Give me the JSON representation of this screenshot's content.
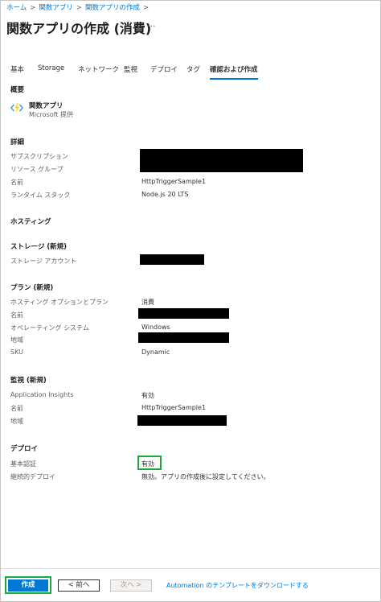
{
  "breadcrumb": {
    "items": [
      "ホーム",
      "関数アプリ",
      "関数アプリの作成"
    ]
  },
  "header": {
    "title": "関数アプリの作成 (消費)",
    "more": "···"
  },
  "tabs": [
    "基本",
    "Storage",
    "ネットワーク",
    "監視",
    "デプロイ",
    "タグ",
    "確認および作成"
  ],
  "active_tab": "確認および作成",
  "summary": {
    "heading": "概要",
    "app_name": "関数アプリ",
    "provider": "Microsoft 提供"
  },
  "details": {
    "heading": "詳細",
    "subscription_label": "サブスクリプション",
    "resource_group_label": "リソース グループ",
    "name_label": "名前",
    "name_value": "HttpTriggerSample1",
    "runtime_label": "ランタイム スタック",
    "runtime_value": "Node.js 20 LTS"
  },
  "hosting": {
    "heading": "ホスティング",
    "storage_heading": "ストレージ (新規)",
    "storage_account_label": "ストレージ アカウント",
    "plan_heading": "プラン (新規)",
    "plan_option_label": "ホスティング オプションとプラン",
    "plan_option_value": "消費",
    "plan_name_label": "名前",
    "os_label": "オペレーティング システム",
    "os_value": "Windows",
    "region_label": "地域",
    "sku_label": "SKU",
    "sku_value": "Dynamic"
  },
  "monitoring": {
    "heading": "監視 (新規)",
    "ai_label": "Application Insights",
    "ai_value": "有効",
    "name_label": "名前",
    "name_value": "HttpTriggerSample1",
    "region_label": "地域"
  },
  "deploy": {
    "heading": "デプロイ",
    "basic_auth_label": "基本認証",
    "basic_auth_value": "有効",
    "continuous_label": "継続的デプロイ",
    "continuous_value": "無効。アプリの作成後に設定してください。"
  },
  "footer": {
    "create_label": "作成",
    "prev_label": "< 前へ",
    "next_label": "次へ >",
    "template_link": "Automation のテンプレートをダウンロードする"
  },
  "colors": {
    "accent": "#0078d4",
    "highlight": "#1aaa3c"
  },
  "icons": {
    "app": "function-app-icon"
  }
}
